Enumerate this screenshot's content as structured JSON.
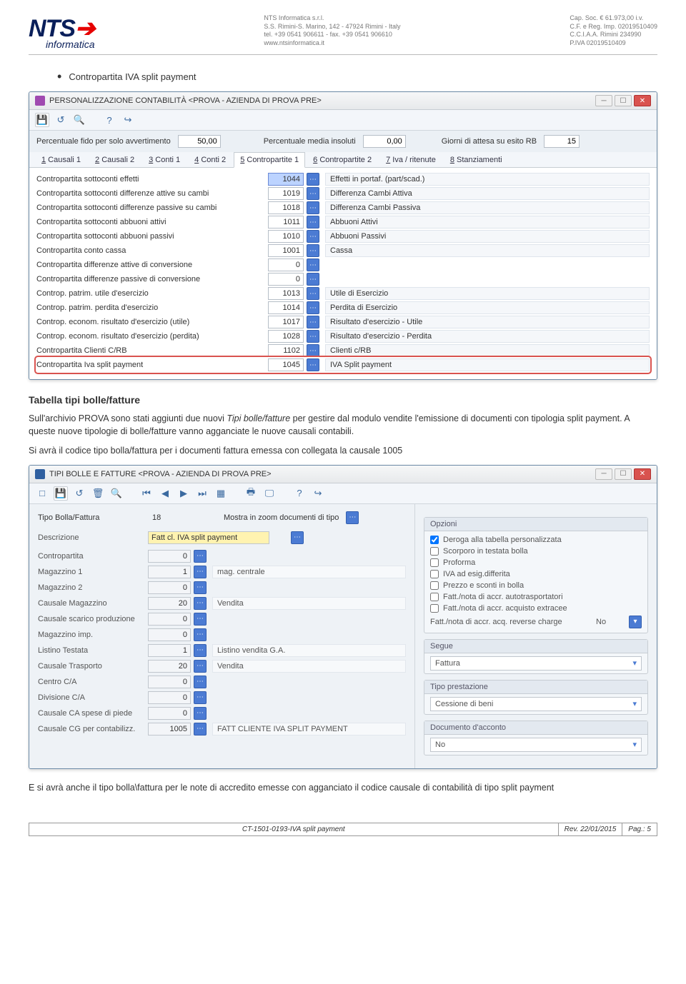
{
  "header": {
    "logo_main": "NTS",
    "logo_sub": "informatica",
    "addr1_l1": "NTS Informatica s.r.l.",
    "addr1_l2": "S.S. Rimini-S. Marino, 142 - 47924 Rimini - Italy",
    "addr1_l3": "tel. +39 0541 906611 - fax. +39 0541 906610",
    "addr1_l4": "www.ntsinformatica.it",
    "addr2_l1": "Cap. Soc. € 61.973,00 i.v.",
    "addr2_l2": "C.F. e Reg. Imp. 02019510409",
    "addr2_l3": "C.C.I.A.A. Rimini 234990",
    "addr2_l4": "P.IVA 02019510409"
  },
  "doc": {
    "bullet1": "Contropartita IVA split payment",
    "h2": "Tabella tipi bolle/fatture",
    "p1a": "Sull'archivio PROVA sono stati aggiunti due nuovi ",
    "p1b": "Tipi bolle/fatture",
    "p1c": " per gestire dal modulo vendite l'emissione di documenti con tipologia split payment. A queste nuove tipologie  di bolle/fatture vanno agganciate le nuove causali contabili.",
    "p2": "Si avrà il codice tipo bolla/fattura per i documenti fattura emessa con collegata la causale 1005",
    "p3": "E si avrà anche il tipo bolla\\fattura per le note di accredito emesse con agganciato il codice causale di contabilità di tipo split payment"
  },
  "win1": {
    "title": "PERSONALIZZAZIONE CONTABILITÀ <PROVA - AZIENDA DI PROVA PRE>",
    "row_lbl1": "Percentuale fido per solo avvertimento",
    "row_val1": "50,00",
    "row_lbl2": "Percentuale media insoluti",
    "row_val2": "0,00",
    "row_lbl3": "Giorni di attesa su esito RB",
    "row_val3": "15",
    "tabs": [
      "1 Causali 1",
      "2 Causali 2",
      "3 Conti 1",
      "4 Conti 2",
      "5 Contropartite 1",
      "6 Contropartite 2",
      "7 Iva / ritenute",
      "8 Stanziamenti"
    ],
    "tab_underlines": [
      "1",
      "2",
      "3",
      "4",
      "5",
      "6",
      "7",
      "8"
    ],
    "active_tab": 4,
    "rows": [
      {
        "lbl": "Contropartita sottoconti effetti",
        "code": "1044",
        "desc": "Effetti in portaf. (part/scad.)",
        "hl": true
      },
      {
        "lbl": "Contropartita sottoconti differenze attive su cambi",
        "code": "1019",
        "desc": "Differenza Cambi Attiva"
      },
      {
        "lbl": "Contropartita sottoconti differenze passive su cambi",
        "code": "1018",
        "desc": "Differenza Cambi Passiva"
      },
      {
        "lbl": "Contropartita sottoconti abbuoni attivi",
        "code": "1011",
        "desc": "Abbuoni Attivi"
      },
      {
        "lbl": "Contropartita sottoconti abbuoni passivi",
        "code": "1010",
        "desc": "Abbuoni Passivi"
      },
      {
        "lbl": "Contropartita conto cassa",
        "code": "1001",
        "desc": "Cassa"
      },
      {
        "lbl": "Contropartita differenze attive di conversione",
        "code": "0",
        "desc": ""
      },
      {
        "lbl": "Contropartita differenze passive di conversione",
        "code": "0",
        "desc": ""
      },
      {
        "lbl": "Controp. patrim. utile d'esercizio",
        "code": "1013",
        "desc": "Utile di Esercizio"
      },
      {
        "lbl": "Controp. patrim. perdita d'esercizio",
        "code": "1014",
        "desc": "Perdita di Esercizio"
      },
      {
        "lbl": "Controp. econom. risultato d'esercizio (utile)",
        "code": "1017",
        "desc": "Risultato d'esercizio - Utile"
      },
      {
        "lbl": "Controp. econom. risultato d'esercizio (perdita)",
        "code": "1028",
        "desc": "Risultato d'esercizio - Perdita"
      },
      {
        "lbl": "Contropartita Clienti C/RB",
        "code": "1102",
        "desc": "Clienti c/RB"
      },
      {
        "lbl": "Contropartita Iva split payment",
        "code": "1045",
        "desc": "IVA Split payment",
        "row_hl": true
      }
    ]
  },
  "win2": {
    "title": "TIPI BOLLE E FATTURE <PROVA - AZIENDA DI PROVA PRE>",
    "top_lbl1": "Tipo Bolla/Fattura",
    "top_val1": "18",
    "top_lbl2": "Mostra in zoom documenti di tipo",
    "rows": [
      {
        "lbl": "Descrizione",
        "val": "Fatt cl. IVA split payment",
        "hl": true,
        "desc": "",
        "wide": true
      },
      {
        "lbl": "Contropartita",
        "val": "0",
        "desc": ""
      },
      {
        "lbl": "Magazzino 1",
        "val": "1",
        "desc": "mag. centrale"
      },
      {
        "lbl": "Magazzino 2",
        "val": "0",
        "desc": ""
      },
      {
        "lbl": "Causale Magazzino",
        "val": "20",
        "desc": "Vendita"
      },
      {
        "lbl": "Causale scarico produzione",
        "val": "0",
        "desc": ""
      },
      {
        "lbl": "Magazzino imp.",
        "val": "0",
        "desc": ""
      },
      {
        "lbl": "Listino Testata",
        "val": "1",
        "desc": "Listino vendita G.A."
      },
      {
        "lbl": "Causale Trasporto",
        "val": "20",
        "desc": "Vendita"
      },
      {
        "lbl": "Centro C/A",
        "val": "0",
        "desc": ""
      },
      {
        "lbl": "Divisione C/A",
        "val": "0",
        "desc": ""
      },
      {
        "lbl": "Causale CA spese di piede",
        "val": "0",
        "desc": ""
      },
      {
        "lbl": "Causale CG per contabilizz.",
        "val": "1005",
        "desc": "FATT CLIENTE IVA SPLIT PAYMENT"
      }
    ],
    "opts_hdr": "Opzioni",
    "opts": [
      {
        "label": "Deroga alla tabella personalizzata",
        "checked": true
      },
      {
        "label": "Scorporo in testata bolla",
        "checked": false
      },
      {
        "label": "Proforma",
        "checked": false
      },
      {
        "label": "IVA ad esig.differita",
        "checked": false
      },
      {
        "label": "Prezzo e sconti in bolla",
        "checked": false
      },
      {
        "label": "Fatt./nota di accr. autotrasportatori",
        "checked": false
      },
      {
        "label": "Fatt./nota di accr. acquisto extracee",
        "checked": false
      }
    ],
    "opt_reverse_lbl": "Fatt./nota di accr. acq. reverse charge",
    "opt_reverse_val": "No",
    "grp_segue": "Segue",
    "grp_segue_val": "Fattura",
    "grp_tipo": "Tipo prestazione",
    "grp_tipo_val": "Cessione di beni",
    "grp_doc": "Documento d'acconto",
    "grp_doc_val": "No"
  },
  "footer": {
    "doc": "CT-1501-0193-IVA split payment",
    "rev": "Rev. 22/01/2015",
    "pag": "Pag.: 5"
  }
}
